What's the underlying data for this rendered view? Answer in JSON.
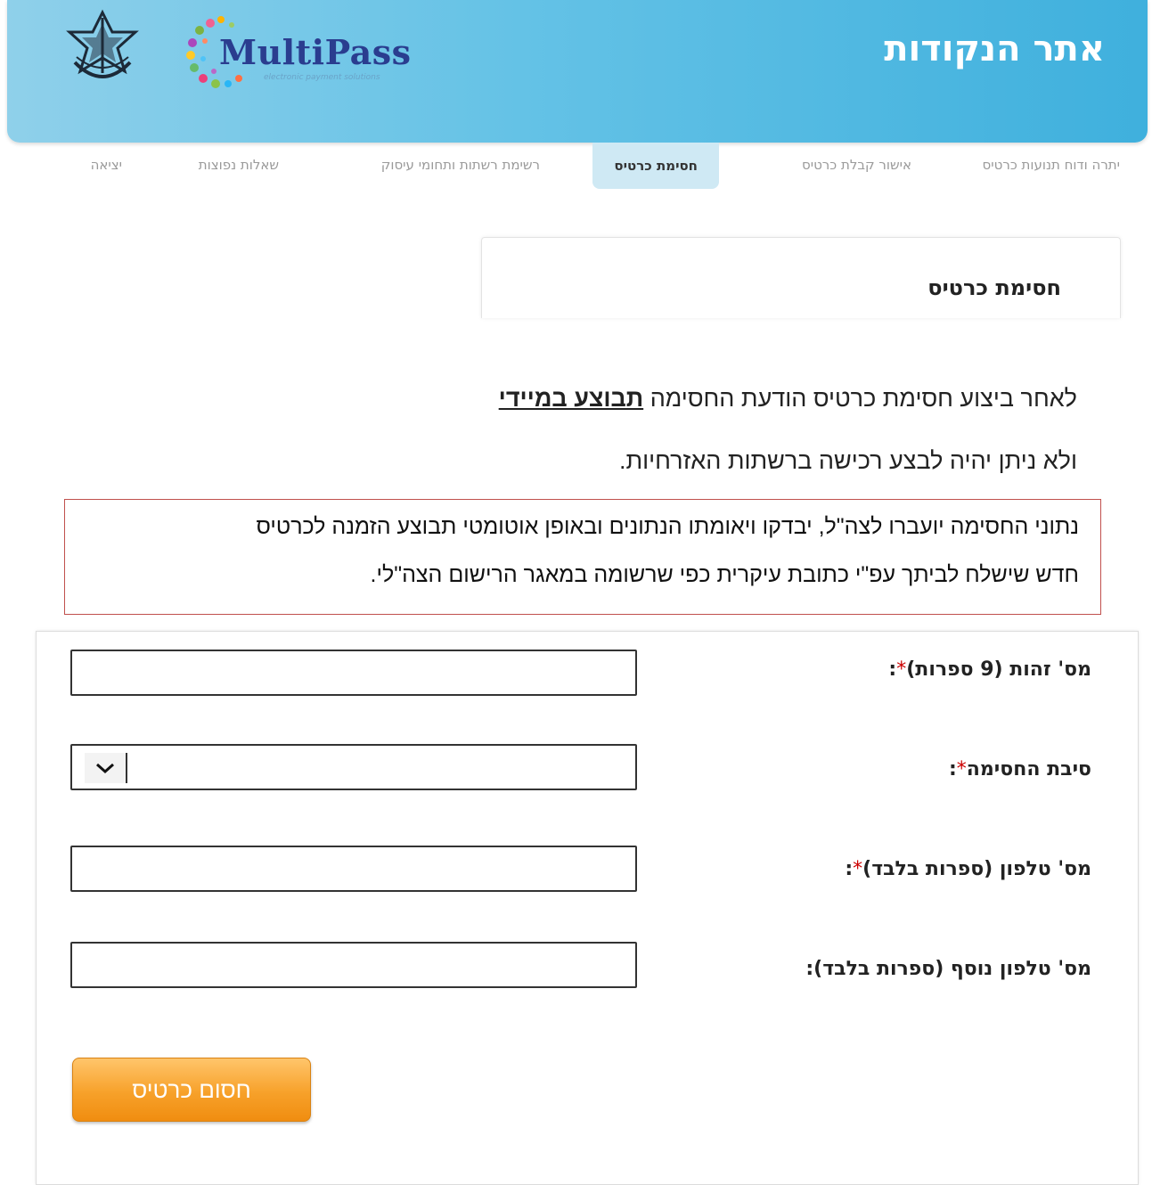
{
  "header": {
    "site_title": "אתר הנקודות",
    "logo_text": "MultiPass",
    "logo_subtext": "electronic payment solutions"
  },
  "nav": {
    "items": [
      {
        "label": "יתרה ודוח תנועות כרטיס"
      },
      {
        "label": "אישור קבלת כרטיס"
      },
      {
        "label": "חסימת כרטיס"
      },
      {
        "label": "רשימת רשתות ותחומי עיסוק"
      },
      {
        "label": "שאלות נפוצות"
      },
      {
        "label": "יציאה"
      }
    ],
    "active": "חסימת כרטיס"
  },
  "panel": {
    "title": "חסימת כרטיס"
  },
  "notice": {
    "line1_prefix": "לאחר ביצוע חסימת כרטיס הודעת החסימה",
    "line1_emphasis": "תבוצע במיידי",
    "line2": "ולא ניתן יהיה לבצע רכישה ברשתות האזרחיות."
  },
  "warning": {
    "line1": "נתוני החסימה יועברו לצה\"ל, יבדקו ויאומתו הנתונים ובאופן אוטומטי תבוצע הזמנה לכרטיס",
    "line2": "חדש שישלח לביתך עפ\"י כתובת עיקרית כפי שרשומה במאגר הרישום הצה\"לי."
  },
  "form": {
    "id_label": "מס' זהות (9 ספרות)",
    "reason_label": "סיבת החסימה",
    "phone_label": "מס' טלפון (ספרות בלבד)",
    "phone2_label": "מס' טלפון נוסף (ספרות בלבד):",
    "required_mark": "*",
    "colon": ":",
    "submit_label": "חסום כרטיס"
  }
}
